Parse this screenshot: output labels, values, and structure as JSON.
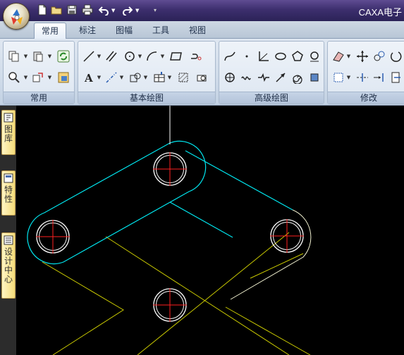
{
  "window": {
    "title": "CAXA电子"
  },
  "quick_access": {
    "icons": [
      "new-file-icon",
      "open-folder-icon",
      "save-icon",
      "print-icon",
      "undo-icon",
      "redo-icon",
      "customize-qat-icon"
    ]
  },
  "ribbon": {
    "tabs": [
      {
        "label": "常用",
        "active": true
      },
      {
        "label": "标注",
        "active": false
      },
      {
        "label": "图幅",
        "active": false
      },
      {
        "label": "工具",
        "active": false
      },
      {
        "label": "视图",
        "active": false
      }
    ],
    "groups": [
      {
        "label": "常用"
      },
      {
        "label": "基本绘图"
      },
      {
        "label": "高级绘图"
      },
      {
        "label": "修改"
      }
    ]
  },
  "side_panel": {
    "tabs": [
      {
        "label": "图库"
      },
      {
        "label": "特性"
      },
      {
        "label": "设计中心"
      }
    ]
  },
  "drawing": {
    "background": "#000000",
    "colors": {
      "outline": "#00e5ee",
      "circle": "#ffffff",
      "centerline": "#ff2020",
      "construction": "#c8c800",
      "axis": "#ffffff"
    }
  }
}
